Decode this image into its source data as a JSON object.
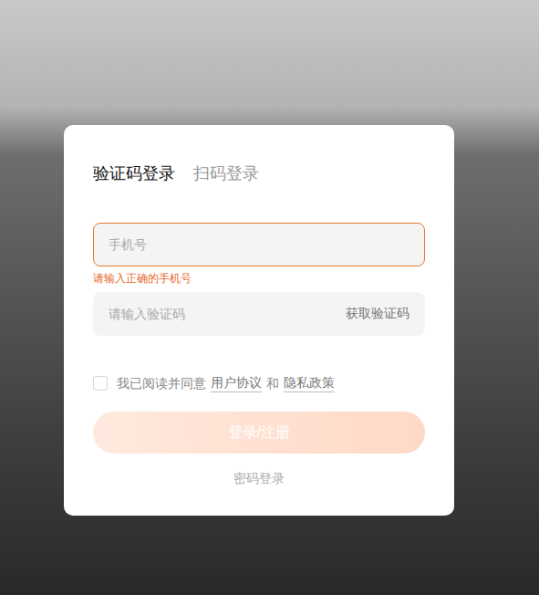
{
  "tabs": [
    {
      "label": "验证码登录",
      "selected": true
    },
    {
      "label": "扫码登录",
      "selected": false
    }
  ],
  "phone": {
    "placeholder": "手机号",
    "error": true,
    "error_text": "请输入正确的手机号"
  },
  "code": {
    "placeholder": "请输入验证码",
    "get_code": "获取验证码"
  },
  "agreement": {
    "checked": false,
    "prefix": "我已阅读并同意",
    "terms": "用户协议",
    "joiner": "和",
    "privacy": "隐私政策"
  },
  "submit": {
    "label": "登录/注册",
    "disabled": true
  },
  "alt_login": "密码登录"
}
